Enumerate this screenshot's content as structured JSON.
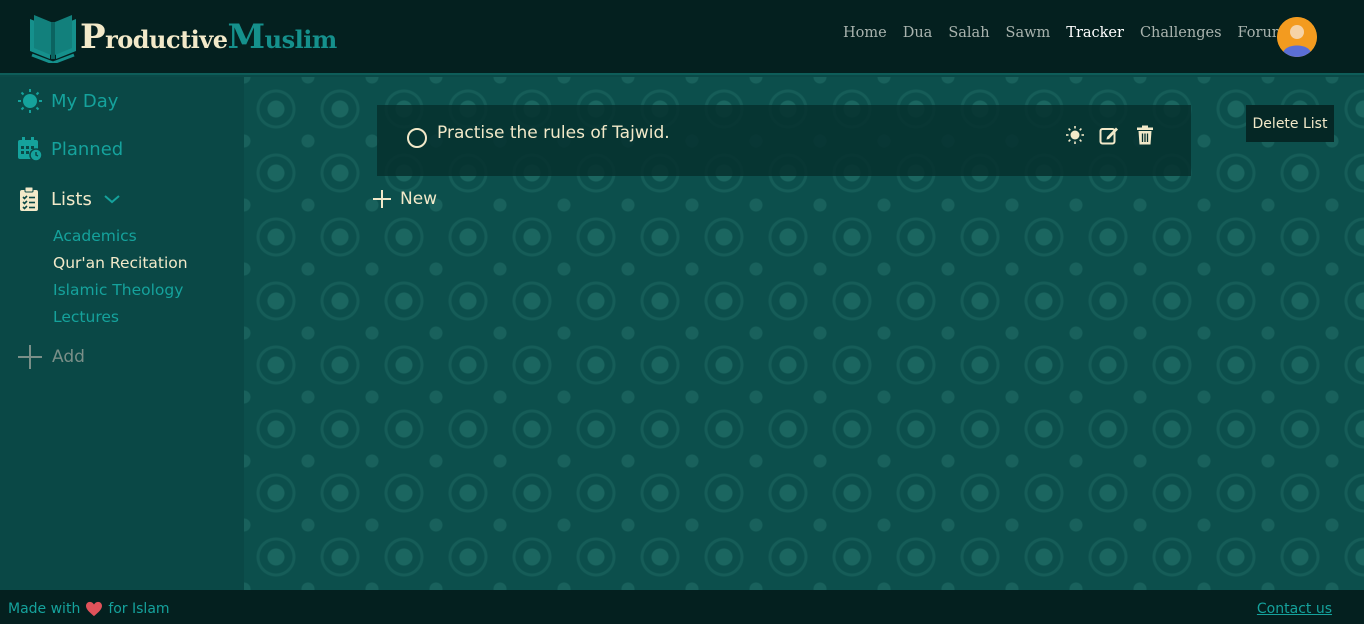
{
  "brand": {
    "part1_cap": "P",
    "part1_rest": "roductive",
    "part2_cap": "M",
    "part2_rest": "uslim"
  },
  "nav": {
    "items": [
      "Home",
      "Dua",
      "Salah",
      "Sawm",
      "Tracker",
      "Challenges",
      "Forum"
    ],
    "active": "Tracker"
  },
  "sidebar": {
    "my_day": "My Day",
    "planned": "Planned",
    "lists": "Lists",
    "list_items": [
      "Academics",
      "Qur'an Recitation",
      "Islamic Theology",
      "Lectures"
    ],
    "active_list": "Qur'an Recitation",
    "add": "Add"
  },
  "main": {
    "task": "Practise the rules of Tajwid.",
    "new": "New",
    "delete_list": "Delete List"
  },
  "footer": {
    "made_with": "Made with",
    "for_islam": "for Islam",
    "contact": "Contact us"
  },
  "colors": {
    "accent": "#15a29c",
    "cream": "#f2e9c9",
    "header_bg": "#04201f",
    "heart": "#e0525a"
  }
}
